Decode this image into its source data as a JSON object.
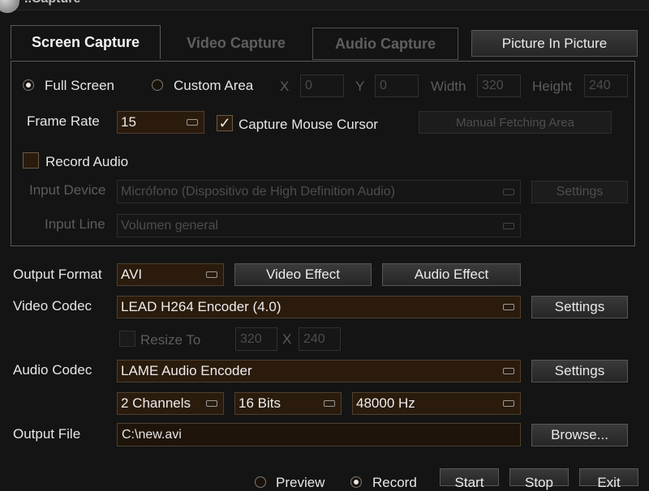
{
  "window": {
    "title": "..Capture"
  },
  "tabs": [
    {
      "label": "Screen Capture"
    },
    {
      "label": "Video Capture"
    },
    {
      "label": "Audio Capture"
    },
    {
      "label": "Picture In Picture"
    }
  ],
  "screen": {
    "mode_full": "Full Screen",
    "mode_custom": "Custom Area",
    "x_label": "X",
    "x_value": "0",
    "y_label": "Y",
    "y_value": "0",
    "width_label": "Width",
    "width_value": "320",
    "height_label": "Height",
    "height_value": "240",
    "frame_rate_label": "Frame Rate",
    "frame_rate_value": "15",
    "capture_cursor_label": "Capture Mouse Cursor",
    "manual_area_label": "Manual Fetching Area",
    "record_audio_label": "Record Audio",
    "input_device_label": "Input Device",
    "input_device_value": "Micrófono (Dispositivo de High Definition Audio)",
    "input_settings_label": "Settings",
    "input_line_label": "Input Line",
    "input_line_value": "Volumen general"
  },
  "output": {
    "format_label": "Output Format",
    "format_value": "AVI",
    "video_effect_label": "Video Effect",
    "audio_effect_label": "Audio Effect",
    "video_codec_label": "Video Codec",
    "video_codec_value": "LEAD H264 Encoder (4.0)",
    "video_settings_label": "Settings",
    "resize_label": "Resize To",
    "resize_w": "320",
    "resize_x": "X",
    "resize_h": "240",
    "audio_codec_label": "Audio Codec",
    "audio_codec_value": "LAME Audio Encoder",
    "audio_settings_label": "Settings",
    "channels_value": "2 Channels",
    "bits_value": "16 Bits",
    "rate_value": "48000 Hz",
    "file_label": "Output File",
    "file_value": "C:\\new.avi",
    "browse_label": "Browse..."
  },
  "footer": {
    "preview_label": "Preview",
    "record_label": "Record",
    "start_label": "Start",
    "stop_label": "Stop",
    "exit_label": "Exit"
  }
}
